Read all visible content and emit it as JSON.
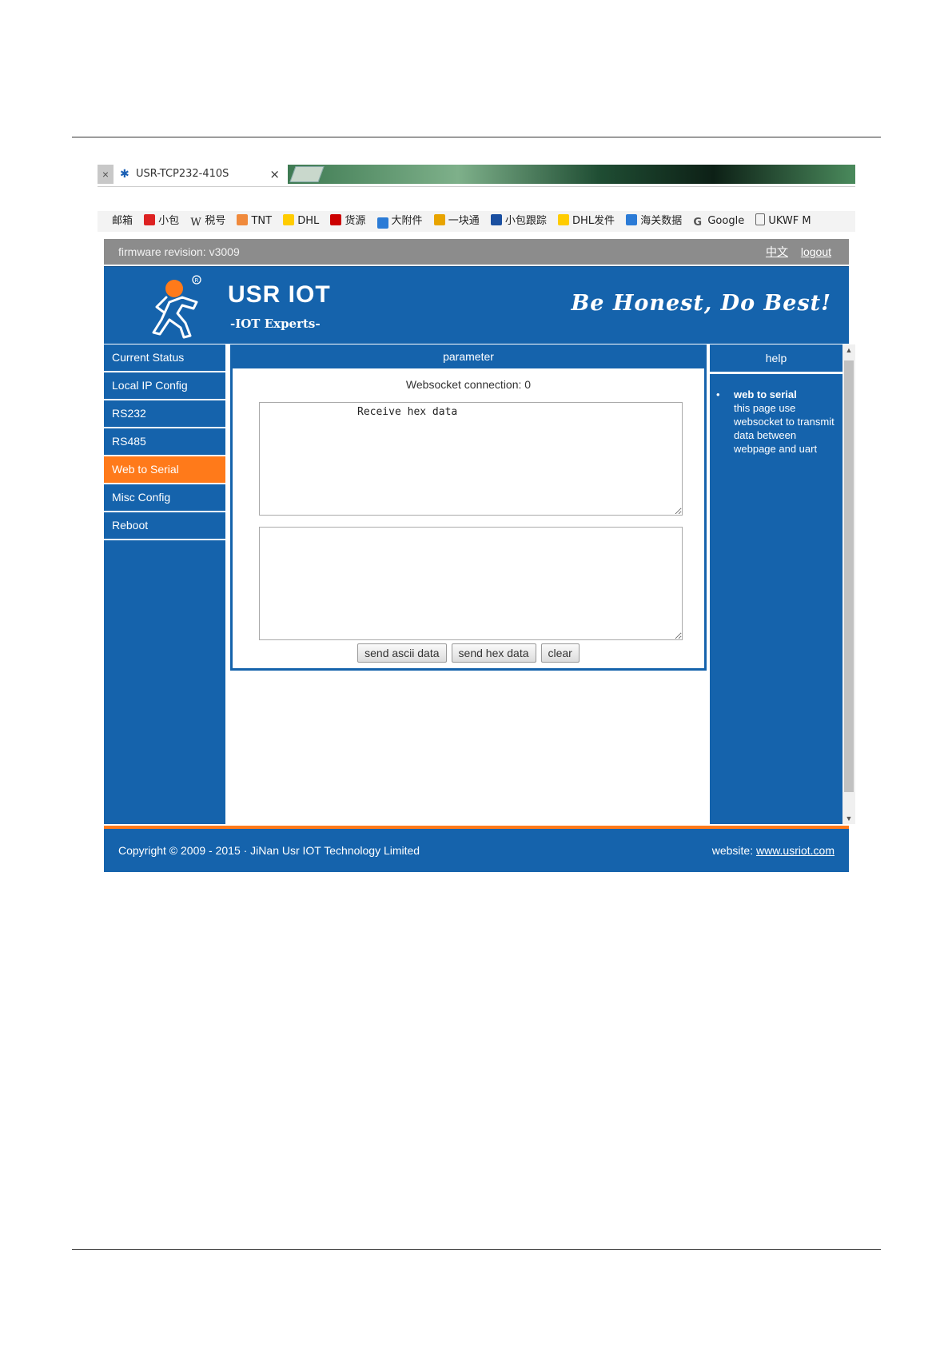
{
  "browser": {
    "tab_title": "USR-TCP232-410S",
    "bookmarks": [
      {
        "label": "邮箱",
        "color": "#ffffff"
      },
      {
        "label": "小包",
        "color": "#d22"
      },
      {
        "label": "税号",
        "color": "#ffffff"
      },
      {
        "label": "TNT",
        "color": "#f08a3c"
      },
      {
        "label": "DHL",
        "color": "#ffcc00"
      },
      {
        "label": "货源",
        "color": "#c00"
      },
      {
        "label": "大附件",
        "color": "#2b7bd6"
      },
      {
        "label": "一块通",
        "color": "#e8a400"
      },
      {
        "label": "小包跟踪",
        "color": "#1a4fa0"
      },
      {
        "label": "DHL发件",
        "color": "#ffcc00"
      },
      {
        "label": "海关数据",
        "color": "#2b7bd6"
      },
      {
        "label": "Google",
        "color": "#ffffff"
      },
      {
        "label": "UKWF M",
        "color": "#ffffff"
      }
    ]
  },
  "topbar": {
    "firmware": "firmware revision: v3009",
    "lang_link": "中文",
    "logout_link": "logout"
  },
  "header": {
    "brand": "USR IOT",
    "tagline": "-IOT Experts-",
    "slogan": "Be Honest, Do Best!"
  },
  "sidebar": {
    "items": [
      {
        "label": "Current Status"
      },
      {
        "label": "Local IP Config"
      },
      {
        "label": "RS232"
      },
      {
        "label": "RS485"
      },
      {
        "label": "Web to Serial",
        "active": true
      },
      {
        "label": "Misc Config"
      },
      {
        "label": "Reboot"
      }
    ]
  },
  "main": {
    "heading": "parameter",
    "ws_status": "Websocket connection: 0",
    "receive_text": "Receive hex data",
    "send_text": "",
    "buttons": {
      "send_ascii": "send ascii data",
      "send_hex": "send hex data",
      "clear": "clear"
    }
  },
  "help": {
    "heading": "help",
    "title": "web to serial",
    "text": "this page use websocket to transmit data between webpage and uart"
  },
  "footer": {
    "copyright": "Copyright © 2009 - 2015 · JiNan Usr IOT Technology Limited",
    "website_label": "website:",
    "website_link": "www.usriot.com"
  },
  "colors": {
    "primary_blue": "#1563ac",
    "accent_orange": "#ff7a1a",
    "topbar_gray": "#8c8c8c"
  }
}
